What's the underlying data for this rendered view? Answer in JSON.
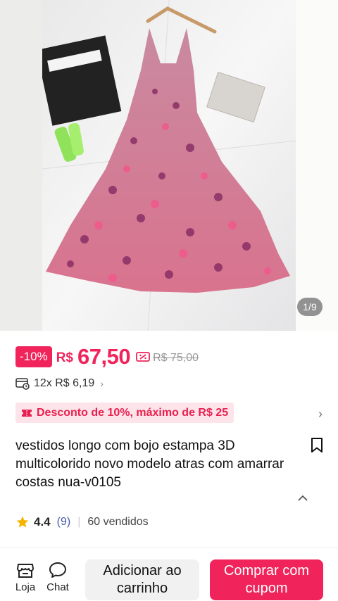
{
  "gallery": {
    "counter": "1/9"
  },
  "price": {
    "discount_badge": "-10%",
    "currency": "R$",
    "current": "67,50",
    "original": "R$ 75,00"
  },
  "installments": {
    "text": "12x R$ 6,19"
  },
  "promo": {
    "text": "Desconto de 10%, máximo de R$ 25"
  },
  "product": {
    "title": "vestidos longo  com bojo estampa 3D multicolorido novo modelo atras com amarrar costas nua-v0105"
  },
  "rating": {
    "score": "4.4",
    "count": "(9)",
    "sold": "60 vendidos"
  },
  "bottom_bar": {
    "store_label": "Loja",
    "chat_label": "Chat",
    "add_to_cart_label": "Adicionar ao carrinho",
    "buy_label": "Comprar com cupom"
  },
  "colors": {
    "accent": "#f0245b",
    "promo_bg": "#fde4ea",
    "star": "#f5b400"
  }
}
